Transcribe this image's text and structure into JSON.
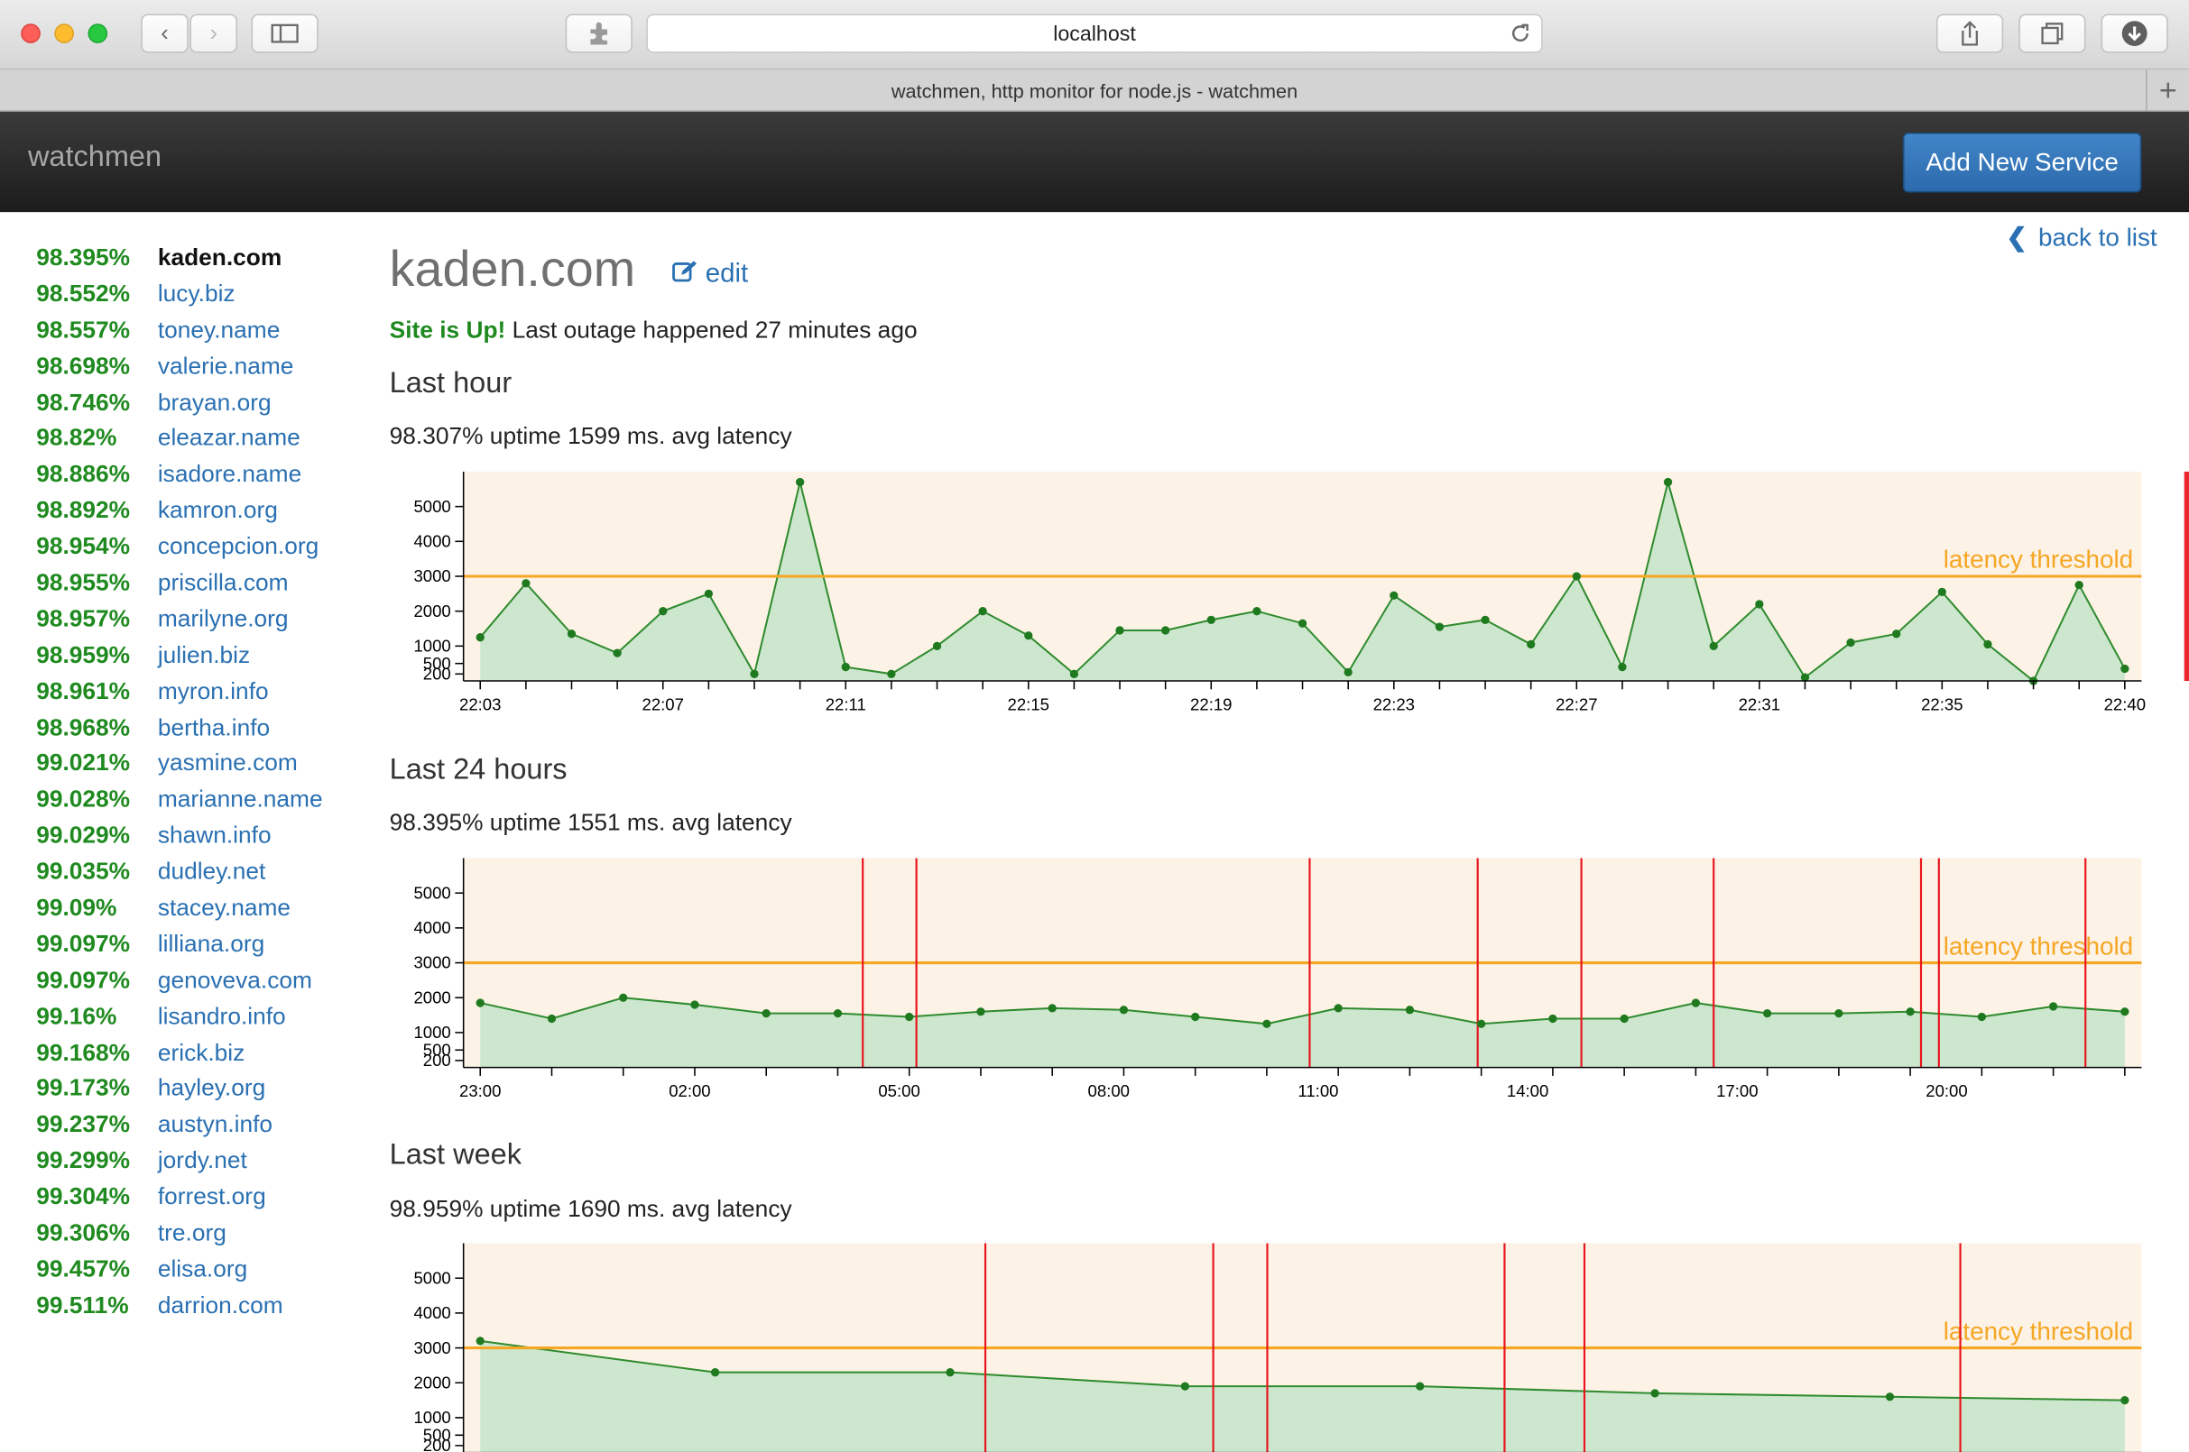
{
  "browser": {
    "url": "localhost",
    "tab_title": "watchmen, http monitor for node.js - watchmen"
  },
  "navbar": {
    "brand": "watchmen",
    "add_button": "Add New Service"
  },
  "sidebar": {
    "items": [
      {
        "uptime": "98.395%",
        "name": "kaden.com",
        "active": true
      },
      {
        "uptime": "98.552%",
        "name": "lucy.biz"
      },
      {
        "uptime": "98.557%",
        "name": "toney.name"
      },
      {
        "uptime": "98.698%",
        "name": "valerie.name"
      },
      {
        "uptime": "98.746%",
        "name": "brayan.org"
      },
      {
        "uptime": "98.82%",
        "name": "eleazar.name"
      },
      {
        "uptime": "98.886%",
        "name": "isadore.name"
      },
      {
        "uptime": "98.892%",
        "name": "kamron.org"
      },
      {
        "uptime": "98.954%",
        "name": "concepcion.org"
      },
      {
        "uptime": "98.955%",
        "name": "priscilla.com"
      },
      {
        "uptime": "98.957%",
        "name": "marilyne.org"
      },
      {
        "uptime": "98.959%",
        "name": "julien.biz"
      },
      {
        "uptime": "98.961%",
        "name": "myron.info"
      },
      {
        "uptime": "98.968%",
        "name": "bertha.info"
      },
      {
        "uptime": "99.021%",
        "name": "yasmine.com"
      },
      {
        "uptime": "99.028%",
        "name": "marianne.name"
      },
      {
        "uptime": "99.029%",
        "name": "shawn.info"
      },
      {
        "uptime": "99.035%",
        "name": "dudley.net"
      },
      {
        "uptime": "99.09%",
        "name": "stacey.name"
      },
      {
        "uptime": "99.097%",
        "name": "lilliana.org"
      },
      {
        "uptime": "99.097%",
        "name": "genoveva.com"
      },
      {
        "uptime": "99.16%",
        "name": "lisandro.info"
      },
      {
        "uptime": "99.168%",
        "name": "erick.biz"
      },
      {
        "uptime": "99.173%",
        "name": "hayley.org"
      },
      {
        "uptime": "99.237%",
        "name": "austyn.info"
      },
      {
        "uptime": "99.299%",
        "name": "jordy.net"
      },
      {
        "uptime": "99.304%",
        "name": "forrest.org"
      },
      {
        "uptime": "99.306%",
        "name": "tre.org"
      },
      {
        "uptime": "99.457%",
        "name": "elisa.org"
      },
      {
        "uptime": "99.511%",
        "name": "darrion.com"
      }
    ]
  },
  "main": {
    "back_link": "back to list",
    "title": "kaden.com",
    "edit_link": "edit",
    "status_up": "Site is Up!",
    "status_text": "Last outage happened 27 minutes ago",
    "sections": [
      {
        "heading": "Last hour",
        "stats": "98.307% uptime 1599 ms. avg latency"
      },
      {
        "heading": "Last 24 hours",
        "stats": "98.395% uptime 1551 ms. avg latency"
      },
      {
        "heading": "Last week",
        "stats": "98.959% uptime 1690 ms. avg latency"
      }
    ]
  },
  "colors": {
    "uptime_green": "#1f8a1f",
    "link_blue": "#2a70b2",
    "threshold_orange": "#f5a623",
    "outage_red": "#e8151b",
    "area_fill": "#cde6ce",
    "plot_bg": "#fdf2e6"
  },
  "chart_data": [
    {
      "type": "area",
      "title": "Last hour",
      "ylim": [
        0,
        6000
      ],
      "y_ticks": [
        200,
        500,
        1000,
        2000,
        3000,
        4000,
        5000
      ],
      "threshold": 3000,
      "threshold_label": "latency threshold",
      "x_labels": [
        "22:03",
        "22:07",
        "22:11",
        "22:15",
        "22:19",
        "22:23",
        "22:27",
        "22:31",
        "22:35",
        "22:40"
      ],
      "values": [
        1250,
        2800,
        1350,
        800,
        2000,
        2500,
        200,
        5700,
        400,
        200,
        1000,
        2000,
        1300,
        200,
        1450,
        1450,
        1750,
        2000,
        1650,
        250,
        2450,
        1550,
        1750,
        1050,
        3000,
        400,
        5700,
        1000,
        2200,
        100,
        1100,
        1350,
        2550,
        1050,
        0,
        2750,
        350
      ],
      "outages": [
        [
          37.3,
          38.3
        ]
      ]
    },
    {
      "type": "area",
      "title": "Last 24 hours",
      "ylim": [
        0,
        6000
      ],
      "y_ticks": [
        200,
        500,
        1000,
        2000,
        3000,
        4000,
        5000
      ],
      "threshold": 3000,
      "threshold_label": "latency threshold",
      "x_labels": [
        "23:00",
        "02:00",
        "05:00",
        "08:00",
        "11:00",
        "14:00",
        "17:00",
        "20:00"
      ],
      "values": [
        1850,
        1400,
        2000,
        1800,
        1550,
        1550,
        1450,
        1600,
        1700,
        1650,
        1450,
        1250,
        1700,
        1650,
        1250,
        1400,
        1400,
        1850,
        1550,
        1550,
        1600,
        1450,
        1750,
        1600
      ],
      "outages": [
        [
          5.35
        ],
        [
          6.1
        ],
        [
          11.6
        ],
        [
          13.95
        ],
        [
          15.4
        ],
        [
          17.25
        ],
        [
          20.15
        ],
        [
          20.4
        ],
        [
          22.45
        ]
      ]
    },
    {
      "type": "area",
      "title": "Last week",
      "ylim": [
        0,
        6000
      ],
      "y_ticks": [
        200,
        500,
        1000,
        2000,
        3000,
        4000,
        5000
      ],
      "threshold": 3000,
      "threshold_label": "latency threshold",
      "values": [
        3200,
        2300,
        2300,
        1900,
        1900,
        1700,
        1600,
        1500
      ],
      "outages": [
        [
          2.15
        ],
        [
          3.12
        ],
        [
          3.35
        ],
        [
          4.36
        ],
        [
          4.7
        ],
        [
          6.3
        ]
      ]
    }
  ]
}
